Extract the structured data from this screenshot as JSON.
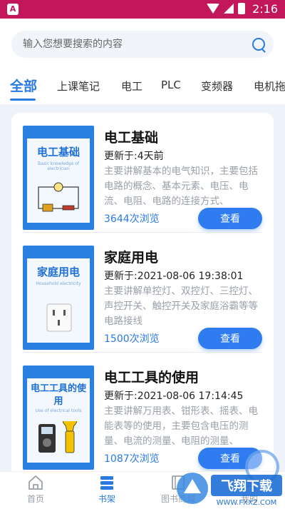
{
  "statusbar": {
    "time": "2:16",
    "app_badge": "A"
  },
  "search": {
    "placeholder": "输入您想要搜索的内容"
  },
  "tabs": [
    {
      "label": "全部",
      "active": true
    },
    {
      "label": "上课笔记"
    },
    {
      "label": "电工"
    },
    {
      "label": "PLC"
    },
    {
      "label": "变频器"
    },
    {
      "label": "电机拖"
    }
  ],
  "items": [
    {
      "title": "电工基础",
      "updated": "更新于:4天前",
      "desc": "主要讲解基本的电气知识，主要包括电路的概念、基本元素、电压、电流、电阻、电路的连接方式、",
      "views": "3644次浏览",
      "button": "查看",
      "cover_title": "电工基础",
      "cover_sub": "Basic knowledge of electrician"
    },
    {
      "title": "家庭用电",
      "updated": "更新于:2021-08-06 19:38:01",
      "desc": "主要讲解单控灯、双控灯、三控灯、声控开关、触控开关及家庭浴霸等等电路接线",
      "views": "1500次浏览",
      "button": "查看",
      "cover_title": "家庭用电",
      "cover_sub": "Household electricity"
    },
    {
      "title": "电工工具的使用",
      "updated": "更新于:2021-08-06 17:14:45",
      "desc": "主要讲解万用表、钳形表、摇表、电能表等的使用，主要包含电压的测量、电流的测量、电阻的测量、",
      "views": "1087次浏览",
      "button": "查看",
      "cover_title": "电工工具的使用",
      "cover_sub": "Use of electrical tools"
    }
  ],
  "bottom_nav": [
    {
      "label": "首页",
      "icon": "home-icon"
    },
    {
      "label": "书架",
      "icon": "bookshelf-icon",
      "active": true
    },
    {
      "label": "图书商城",
      "icon": "book-mall-icon"
    },
    {
      "label": "我的",
      "icon": "profile-icon"
    }
  ],
  "watermark": {
    "text": "飞翔下载",
    "sub": "WWW.FXXZ.COM"
  },
  "colors": {
    "accent": "#2a7ae2",
    "statusbar": "#c2185b",
    "background": "#eef3fb"
  }
}
